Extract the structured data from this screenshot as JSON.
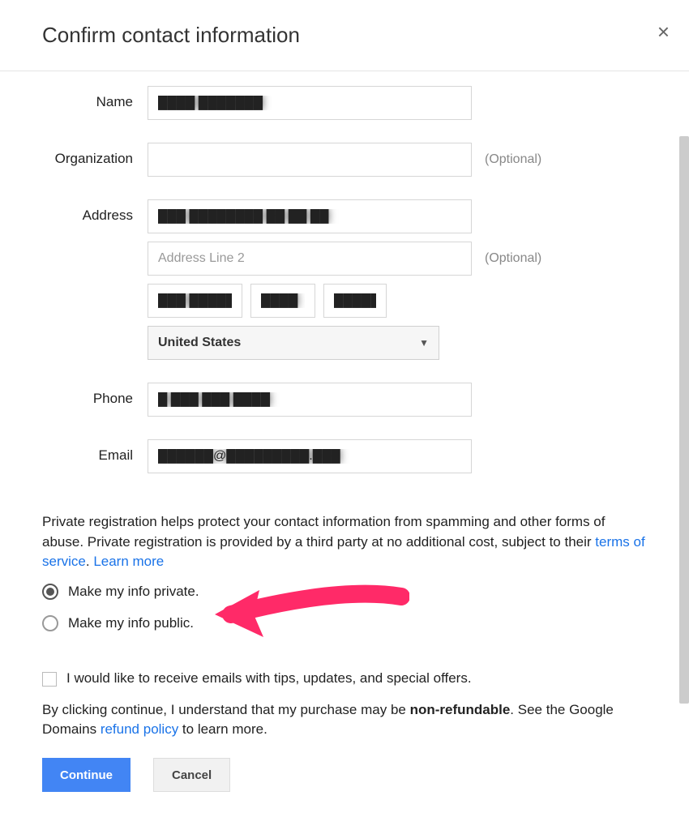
{
  "dialog": {
    "title": "Confirm contact information",
    "close_label": "×"
  },
  "labels": {
    "name": "Name",
    "organization": "Organization",
    "address": "Address",
    "phone": "Phone",
    "email": "Email",
    "optional": "(Optional)"
  },
  "fields": {
    "name_value": "████ ███████",
    "organization_value": "",
    "address1_value": "███ ████████ ██ ██ ██",
    "address2_placeholder": "Address Line 2",
    "address2_value": "",
    "city_value": "███ █████",
    "region_value": "████",
    "postal_value": "█████",
    "country_value": "United States",
    "phone_value": "█ ███ ███ ████",
    "email_value": "██████@█████████.███"
  },
  "privacy": {
    "intro_text": "Private registration helps protect your contact information from spamming and other forms of abuse. Private registration is provided by a third party at no additional cost, subject to their ",
    "terms_link": "terms of service",
    "period_space": ". ",
    "learn_more": "Learn more",
    "option_private": "Make my info private.",
    "option_public": "Make my info public."
  },
  "emails_opt_in": "I would like to receive emails with tips, updates, and special offers.",
  "footer": {
    "pre": "By clicking continue, I understand that my purchase may be ",
    "nonrefundable": "non-refundable",
    "mid": ". See the Google Domains ",
    "refund_link": "refund policy",
    "post": " to learn more."
  },
  "buttons": {
    "continue": "Continue",
    "cancel": "Cancel"
  }
}
